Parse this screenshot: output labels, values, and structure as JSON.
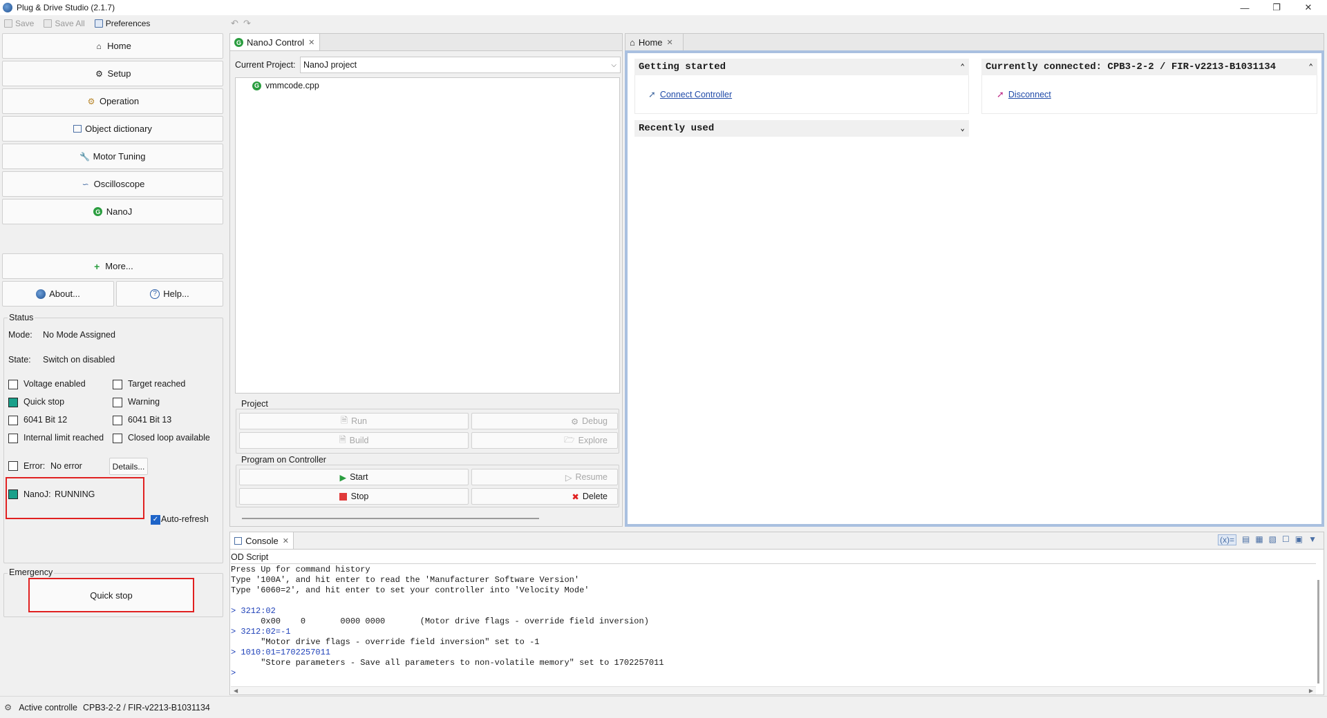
{
  "window": {
    "title": "Plug & Drive Studio (2.1.7)"
  },
  "toolbar": {
    "save": "Save",
    "save_all": "Save All",
    "preferences": "Preferences"
  },
  "nav": {
    "home": "Home",
    "setup": "Setup",
    "operation": "Operation",
    "object_dictionary": "Object dictionary",
    "motor_tuning": "Motor Tuning",
    "oscilloscope": "Oscilloscope",
    "nanoj": "NanoJ",
    "more": "More...",
    "about": "About...",
    "help": "Help..."
  },
  "status": {
    "group_label": "Status",
    "mode_label": "Mode:",
    "mode_value": "No Mode Assigned",
    "state_label": "State:",
    "state_value": "Switch on disabled",
    "checks": [
      {
        "label": "Voltage enabled",
        "checked": false
      },
      {
        "label": "Target reached",
        "checked": false
      },
      {
        "label": "Quick stop",
        "checked": true
      },
      {
        "label": "Warning",
        "checked": false
      },
      {
        "label": "6041 Bit 12",
        "checked": false
      },
      {
        "label": "6041 Bit 13",
        "checked": false
      },
      {
        "label": "Internal limit reached",
        "checked": false
      },
      {
        "label": "Closed loop available",
        "checked": false
      }
    ],
    "error_label": "Error:",
    "error_value": "No error",
    "details_button": "Details...",
    "nanoj_label": "NanoJ:",
    "nanoj_value": "RUNNING",
    "auto_refresh": "Auto-refresh"
  },
  "emergency": {
    "group_label": "Emergency",
    "quick_stop": "Quick stop"
  },
  "nanoj_control": {
    "tab_label": "NanoJ Control",
    "current_project_label": "Current Project:",
    "current_project_value": "NanoJ project",
    "file": "vmmcode.cpp",
    "project_group": "Project",
    "run": "Run",
    "debug": "Debug",
    "build": "Build",
    "explore": "Explore",
    "program_group": "Program on Controller",
    "start": "Start",
    "resume": "Resume",
    "stop": "Stop",
    "delete": "Delete"
  },
  "home": {
    "tab_label": "Home",
    "getting_started": "Getting started",
    "connect_controller": "Connect Controller",
    "recently_used": "Recently used",
    "currently_connected": "Currently connected: CPB3-2-2 / FIR-v2213-B1031134",
    "disconnect": "Disconnect"
  },
  "console": {
    "tab_label": "Console",
    "subtitle": "OD Script",
    "lines": [
      "Press Up for command history",
      "Type '100A', and hit enter to read the 'Manufacturer Software Version'",
      "Type '6060=2', and hit enter to set your controller into 'Velocity Mode'",
      "",
      "> 3212:02",
      "      0x00    0       0000 0000       (Motor drive flags - override field inversion)",
      "> 3212:02=-1",
      "      \"Motor drive flags - override field inversion\" set to -1",
      "> 1010:01=1702257011",
      "      \"Store parameters - Save all parameters to non-volatile memory\" set to 1702257011",
      "",
      ">"
    ]
  },
  "statusbar": {
    "label": "Active controlle",
    "value": "CPB3-2-2 / FIR-v2213-B1031134"
  },
  "colors": {
    "running_green": "#1aa08a",
    "highlight_red": "#e02020",
    "link_blue": "#1f4aa8"
  }
}
